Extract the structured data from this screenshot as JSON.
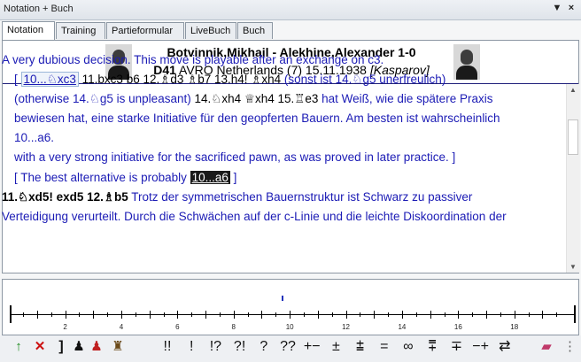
{
  "window": {
    "title": "Notation + Buch"
  },
  "tabs": [
    "Notation",
    "Training",
    "Partieformular",
    "LiveBuch",
    "Buch"
  ],
  "game": {
    "players": "Botvinnik,Mikhail - Alekhine,Alexander  1-0",
    "eco": "D41",
    "event": "AVRO Netherlands (7) 15.11.1938",
    "annotator": "[Kasparov]"
  },
  "notation": {
    "l1": "A very dubious decision. This move is playable after an exchange on c3.",
    "l2a": "[ ",
    "l2_current": "10...♘xc3",
    "l2b": " 11.bxc3  b6  12.♗d3  ♗b7  13.h4!  ♗xh4",
    "l2c": " (sonst ist 14.♘g5 unerfreulich)",
    "l3a": "(otherwise 14.♘g5 is unpleasant)",
    "l3b": "  14.♘xh4  ♕xh4  15.♖e3",
    "l3c": " hat Weiß, wie die spätere Praxis",
    "l4": "bewiesen hat, eine starke Initiative für den geopferten Bauern. Am besten ist wahrscheinlich",
    "l5": "10...a6.",
    "l6": "with a very strong initiative for the sacrificed pawn, as was proved in later practice. ]",
    "l7a": "[ The best alternative is probably ",
    "l7_highlight": "10...a6",
    "l7b": " ]",
    "l8a": "11.♘xd5!  exd5  12.♗b5",
    "l8b": " Trotz der symmetrischen Bauernstruktur ist Schwarz zu passiver",
    "l9": "Verteidigung verurteilt. Durch die Schwächen auf der c-Linie und die leichte Diskoordination der"
  },
  "timeline": {
    "labels": [
      "2",
      "4",
      "6",
      "8",
      "10",
      "12",
      "14",
      "16",
      "18"
    ],
    "current_move": 10
  },
  "toolbar": {
    "symbols": [
      "!!",
      "!",
      "!?",
      "?!",
      "?",
      "??",
      "+−",
      "±",
      "⩲",
      "=",
      "∞",
      "⩱",
      "∓",
      "−+",
      "⇄"
    ]
  }
}
